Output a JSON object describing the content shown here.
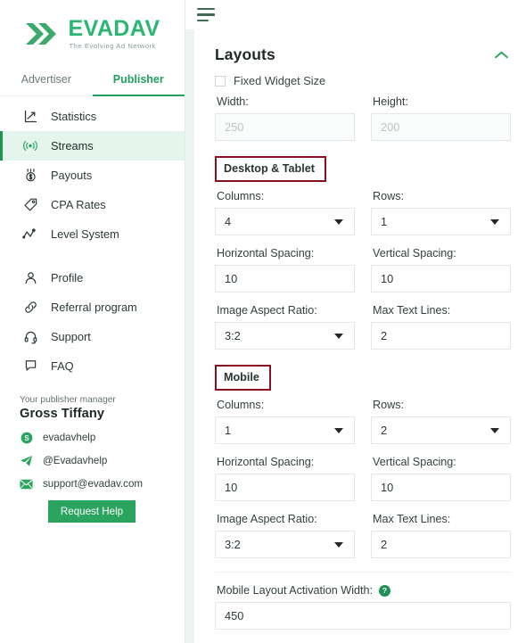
{
  "brand": {
    "name": "EVADAV",
    "tagline": "The Evolving Ad Network",
    "accent": "#2cb673",
    "accent_dark": "#1e9455"
  },
  "sidebar": {
    "tabs": [
      {
        "label": "Advertiser",
        "active": false
      },
      {
        "label": "Publisher",
        "active": true
      }
    ],
    "nav_primary": [
      {
        "label": "Statistics",
        "icon": "chart-arrow-icon",
        "active": false
      },
      {
        "label": "Streams",
        "icon": "broadcast-icon",
        "active": true
      },
      {
        "label": "Payouts",
        "icon": "medal-dollar-icon",
        "active": false
      },
      {
        "label": "CPA Rates",
        "icon": "tag-icon",
        "active": false
      },
      {
        "label": "Level System",
        "icon": "levels-icon",
        "active": false
      }
    ],
    "nav_secondary": [
      {
        "label": "Profile",
        "icon": "user-icon",
        "active": false
      },
      {
        "label": "Referral program",
        "icon": "link-icon",
        "active": false
      },
      {
        "label": "Support",
        "icon": "headset-icon",
        "active": false
      },
      {
        "label": "FAQ",
        "icon": "chat-icon",
        "active": false
      }
    ],
    "manager": {
      "kicker": "Your publisher manager",
      "name": "Gross Tiffany",
      "contacts": [
        {
          "icon": "skype-icon",
          "value": "evadavhelp"
        },
        {
          "icon": "telegram-icon",
          "value": "@Evadavhelp"
        },
        {
          "icon": "email-icon",
          "value": "support@evadav.com"
        }
      ],
      "request_help_label": "Request Help"
    }
  },
  "topbar": {
    "menu_icon": "hamburger-icon"
  },
  "panel": {
    "title": "Layouts",
    "collapse_icon": "chevron-up-icon",
    "fixed_widget_size": {
      "label": "Fixed Widget Size",
      "checked": false
    },
    "size_fields": [
      {
        "label": "Width:",
        "value": "",
        "placeholder": "250",
        "disabled": true
      },
      {
        "label": "Height:",
        "value": "",
        "placeholder": "200",
        "disabled": true
      }
    ],
    "sections": [
      {
        "badge": "Desktop & Tablet",
        "badge_border_color": "#8a1020",
        "fields": [
          {
            "label": "Columns:",
            "type": "select",
            "value": "4"
          },
          {
            "label": "Rows:",
            "type": "select",
            "value": "1"
          },
          {
            "label": "Horizontal Spacing:",
            "type": "input",
            "value": "10"
          },
          {
            "label": "Vertical Spacing:",
            "type": "input",
            "value": "10"
          },
          {
            "label": "Image Aspect Ratio:",
            "type": "select",
            "value": "3:2"
          },
          {
            "label": "Max Text Lines:",
            "type": "input",
            "value": "2"
          }
        ]
      },
      {
        "badge": "Mobile",
        "badge_border_color": "#8a1020",
        "fields": [
          {
            "label": "Columns:",
            "type": "select",
            "value": "1"
          },
          {
            "label": "Rows:",
            "type": "select",
            "value": "2"
          },
          {
            "label": "Horizontal Spacing:",
            "type": "input",
            "value": "10"
          },
          {
            "label": "Vertical Spacing:",
            "type": "input",
            "value": "10"
          },
          {
            "label": "Image Aspect Ratio:",
            "type": "select",
            "value": "3:2"
          },
          {
            "label": "Max Text Lines:",
            "type": "input",
            "value": "2"
          }
        ]
      }
    ],
    "activation": {
      "label": "Mobile Layout Activation Width:",
      "help_icon": "question-mark-icon",
      "help_glyph": "?",
      "value": "450"
    }
  }
}
